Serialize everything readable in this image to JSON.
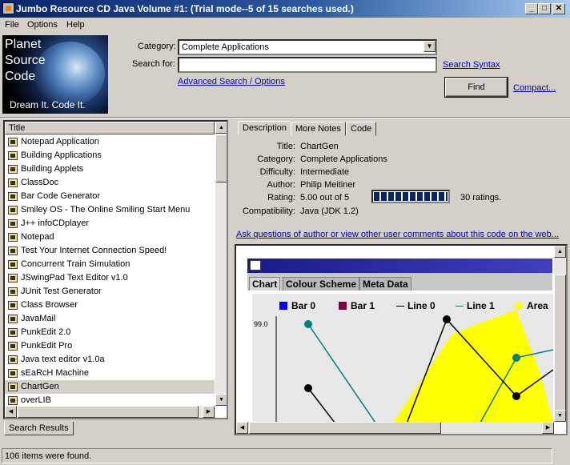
{
  "window": {
    "title": "Jumbo Resource CD Java Volume #1: (Trial mode--5 of 15 searches used.)",
    "controls": {
      "minimize": "_",
      "maximize": "□",
      "close": "✕"
    }
  },
  "menu": [
    "File",
    "Options",
    "Help"
  ],
  "logo": {
    "title": "Planet\nSource\nCode",
    "tagline": "Dream It.  Code It."
  },
  "search": {
    "category_label": "Category:",
    "category_value": "Complete Applications",
    "search_for_label": "Search for:",
    "search_for_value": "",
    "search_syntax_link": "Search Syntax",
    "advanced_link": "Advanced Search / Options",
    "find_button": "Find",
    "compact_link": "Compact..."
  },
  "results": {
    "column_header": "Title",
    "items": [
      "Notepad Application",
      "Building Applications",
      "Building Applets",
      "ClassDoc",
      "Bar Code Generator",
      "Smiley OS - The Online Smiling Start Menu",
      "J++ infoCDplayer",
      "Notepad",
      "Test Your Internet Connection Speed!",
      "Concurrent Train Simulation",
      "JSwingPad Text Editor v1.0",
      "JUnit Test Generator",
      "Class Browser",
      "JavaMail",
      "PunkEdit 2.0",
      "PunkEdit Pro",
      "Java text editor v1.0a",
      "sEaRcH Machine",
      "ChartGen",
      "overLIB"
    ],
    "selected_index": 18,
    "tab_label": "Search Results"
  },
  "detail_tabs": [
    "Description",
    "More Notes",
    "Code"
  ],
  "details": {
    "title_label": "Title:",
    "title": "ChartGen",
    "category_label": "Category:",
    "category": "Complete Applications",
    "difficulty_label": "Difficulty:",
    "difficulty": "Intermediate",
    "author_label": "Author:",
    "author": "Philip Meitiner",
    "rating_label": "Rating:",
    "rating": "5.00 out of 5",
    "rating_fraction": 1.0,
    "ratings_count": "30 ratings.",
    "compat_label": "Compatibility:",
    "compat": "Java (JDK 1.2)",
    "ask_link": "Ask questions of author or view other user comments about this code on the web..."
  },
  "preview": {
    "tabs": [
      "Chart",
      "Colour Scheme",
      "Meta Data"
    ],
    "legend": [
      {
        "name": "Bar 0",
        "color": "#0000ff"
      },
      {
        "name": "Bar 1",
        "color": "#800040"
      },
      {
        "name": "Line 0",
        "color": "#000000"
      },
      {
        "name": "Line 1",
        "color": "#008080"
      },
      {
        "name": "Area",
        "color": "#ffff00"
      }
    ],
    "ytick": "99.0"
  },
  "status": {
    "text": "106 items were found."
  }
}
